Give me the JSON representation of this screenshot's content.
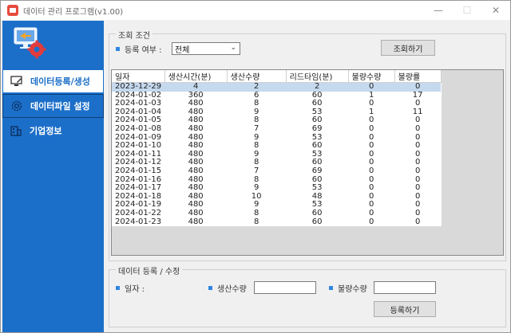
{
  "window": {
    "title": "데이터 관리 프로그램(v1.00)",
    "controls": [
      "—",
      "☐",
      "✕"
    ]
  },
  "sidebar": {
    "logo_icon": "monitor-gear-icon",
    "items": [
      {
        "label": "데이터등록/생성",
        "icon": "monitor-edit-icon",
        "active": true
      },
      {
        "label": "데이터파일 설정",
        "icon": "gear-icon",
        "active": false
      },
      {
        "label": "기업정보",
        "icon": "building-icon",
        "active": false
      }
    ]
  },
  "query": {
    "group_title": "조회 조건",
    "filter_label": "등록 여부 :",
    "filter_value": "전체",
    "search_button": "조회하기"
  },
  "table": {
    "headers": [
      "일자",
      "생산시간(분)",
      "생산수량",
      "리드타임(분)",
      "불량수량",
      "불량률"
    ],
    "rows": [
      [
        "2023-12-29",
        "4",
        "2",
        "2",
        "0",
        "0"
      ],
      [
        "2024-01-02",
        "360",
        "6",
        "60",
        "1",
        "17"
      ],
      [
        "2024-01-03",
        "480",
        "8",
        "60",
        "0",
        "0"
      ],
      [
        "2024-01-04",
        "480",
        "9",
        "53",
        "1",
        "11"
      ],
      [
        "2024-01-05",
        "480",
        "8",
        "60",
        "0",
        "0"
      ],
      [
        "2024-01-08",
        "480",
        "7",
        "69",
        "0",
        "0"
      ],
      [
        "2024-01-09",
        "480",
        "9",
        "53",
        "0",
        "0"
      ],
      [
        "2024-01-10",
        "480",
        "8",
        "60",
        "0",
        "0"
      ],
      [
        "2024-01-11",
        "480",
        "9",
        "53",
        "0",
        "0"
      ],
      [
        "2024-01-12",
        "480",
        "8",
        "60",
        "0",
        "0"
      ],
      [
        "2024-01-15",
        "480",
        "7",
        "69",
        "0",
        "0"
      ],
      [
        "2024-01-16",
        "480",
        "8",
        "60",
        "0",
        "0"
      ],
      [
        "2024-01-17",
        "480",
        "9",
        "53",
        "0",
        "0"
      ],
      [
        "2024-01-18",
        "480",
        "10",
        "48",
        "0",
        "0"
      ],
      [
        "2024-01-19",
        "480",
        "9",
        "53",
        "0",
        "0"
      ],
      [
        "2024-01-22",
        "480",
        "8",
        "60",
        "0",
        "0"
      ],
      [
        "2024-01-23",
        "480",
        "8",
        "60",
        "0",
        "0"
      ]
    ]
  },
  "entry": {
    "group_title": "데이터 등록 / 수정",
    "date_label": "일자 :",
    "qty_label": "생산수량",
    "qty_value": "",
    "defect_label": "불량수량",
    "defect_value": "",
    "register_button": "등록하기"
  },
  "colors": {
    "sidebar": "#1c6fc9",
    "accent": "#2f86e0",
    "selection": "#c5d9ef"
  }
}
